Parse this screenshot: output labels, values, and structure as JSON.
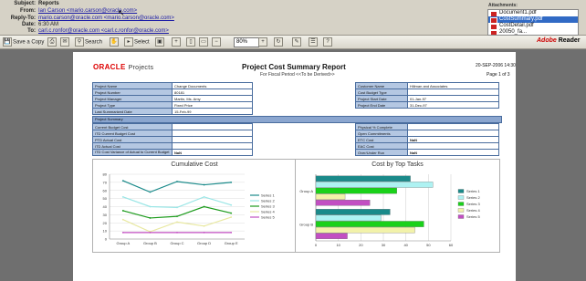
{
  "email": {
    "subject_label": "Subject:",
    "subject": "Reports",
    "from_label": "From:",
    "from": "Ian Carson <mario.carson@oracle.com>",
    "replyto_label": "Reply-To:",
    "replyto": "mario.carson@oracle.com <mario.carson@oracle.com>",
    "date_label": "Date:",
    "date": "6:30 AM",
    "to_label": "To:",
    "to": "carl.c.ronfor@oracle.com <carl.c.ronfor@oracle.com>",
    "attachments_label": "Attachments:",
    "attachments": [
      "Document1.pdf",
      "CostSummary.pdf",
      "CostDetail.pdf",
      "20050_fa..."
    ]
  },
  "toolbar": {
    "save_copy": "Save a Copy",
    "search": "Search",
    "select": "Select",
    "zoom": "80%",
    "adobe": "Adobe",
    "reader": "Reader"
  },
  "report": {
    "brand": "ORACLE",
    "brand_sub": "Projects",
    "title": "Project Cost Summary Report",
    "subtitle": "For Fiscal Period <<To be Derived>>",
    "date": "20-SEP-2006 14:30",
    "page": "Page 1 of 3",
    "left_rows": [
      {
        "k": "Project Name",
        "v": "Change Documents"
      },
      {
        "k": "Project Number",
        "v": "80181"
      },
      {
        "k": "Project Manager",
        "v": "Martin, Ms. Amy"
      },
      {
        "k": "Project Type",
        "v": "Fixed Price"
      },
      {
        "k": "Last Summarized Date",
        "v": "15-Feb-99"
      }
    ],
    "right_rows": [
      {
        "k": "Customer Name",
        "v": "Hillman and Associates"
      },
      {
        "k": "Cost Budget Type",
        "v": ""
      },
      {
        "k": "Project Start Date",
        "v": "01-Jan-97"
      },
      {
        "k": "Project End Date",
        "v": "31-Dec-97"
      },
      {
        "k": "",
        "v": ""
      }
    ],
    "summary_label": "Project Summary",
    "sum_left": [
      {
        "k": "Current Budget Cost",
        "v": ""
      },
      {
        "k": "ITD Current Budget Cost",
        "v": ""
      },
      {
        "k": "PTD Actual Cost",
        "v": ""
      },
      {
        "k": "ITD Actual Cost",
        "v": ""
      },
      {
        "k": "ITD Cost Variance of Actual to Current Budget",
        "v": "NaN"
      }
    ],
    "sum_right": [
      {
        "k": "Physical % Complete",
        "v": ""
      },
      {
        "k": "Open Commitments",
        "v": ""
      },
      {
        "k": "ETC Cost",
        "v": "NaN"
      },
      {
        "k": "EAC Cost",
        "v": ""
      },
      {
        "k": "Over/Under Run",
        "v": "NaN"
      }
    ]
  },
  "chart_data": [
    {
      "type": "line",
      "title": "Cumulative Cost",
      "categories": [
        "Group A",
        "Group B",
        "Group C",
        "Group D",
        "Group E"
      ],
      "ylim": [
        0,
        80
      ],
      "yticks": [
        "0",
        "10",
        "20",
        "30",
        "40",
        "50",
        "60",
        "70",
        "80"
      ],
      "series": [
        {
          "name": "Series 1",
          "color": "#1a8a8a",
          "values": [
            72,
            58,
            71,
            67,
            70
          ]
        },
        {
          "name": "Series 2",
          "color": "#9ae6e6",
          "values": [
            52,
            40,
            39,
            52,
            42
          ]
        },
        {
          "name": "Series 3",
          "color": "#1a9a1a",
          "values": [
            35,
            26,
            28,
            40,
            32
          ]
        },
        {
          "name": "Series 4",
          "color": "#e8e8a0",
          "values": [
            24,
            9,
            21,
            16,
            27
          ]
        },
        {
          "name": "Series 5",
          "color": "#c24fc2",
          "values": [
            8,
            8,
            8,
            8,
            8
          ]
        }
      ]
    },
    {
      "type": "bar",
      "title": "Cost by Top Tasks",
      "categories": [
        "Group A",
        "Group B"
      ],
      "xlim": [
        0,
        60
      ],
      "xticks": [
        "0",
        "10",
        "20",
        "30",
        "40",
        "50",
        "60"
      ],
      "series": [
        {
          "name": "Series 1",
          "color": "#1a8a8a",
          "values": [
            42,
            33
          ]
        },
        {
          "name": "Series 2",
          "color": "#aef2f2",
          "values": [
            52,
            29
          ]
        },
        {
          "name": "Series 3",
          "color": "#1ad11a",
          "values": [
            36,
            48
          ]
        },
        {
          "name": "Series 4",
          "color": "#f2f2aa",
          "values": [
            13,
            44
          ]
        },
        {
          "name": "Series 5",
          "color": "#c24fc2",
          "values": [
            24,
            14
          ]
        }
      ]
    }
  ]
}
